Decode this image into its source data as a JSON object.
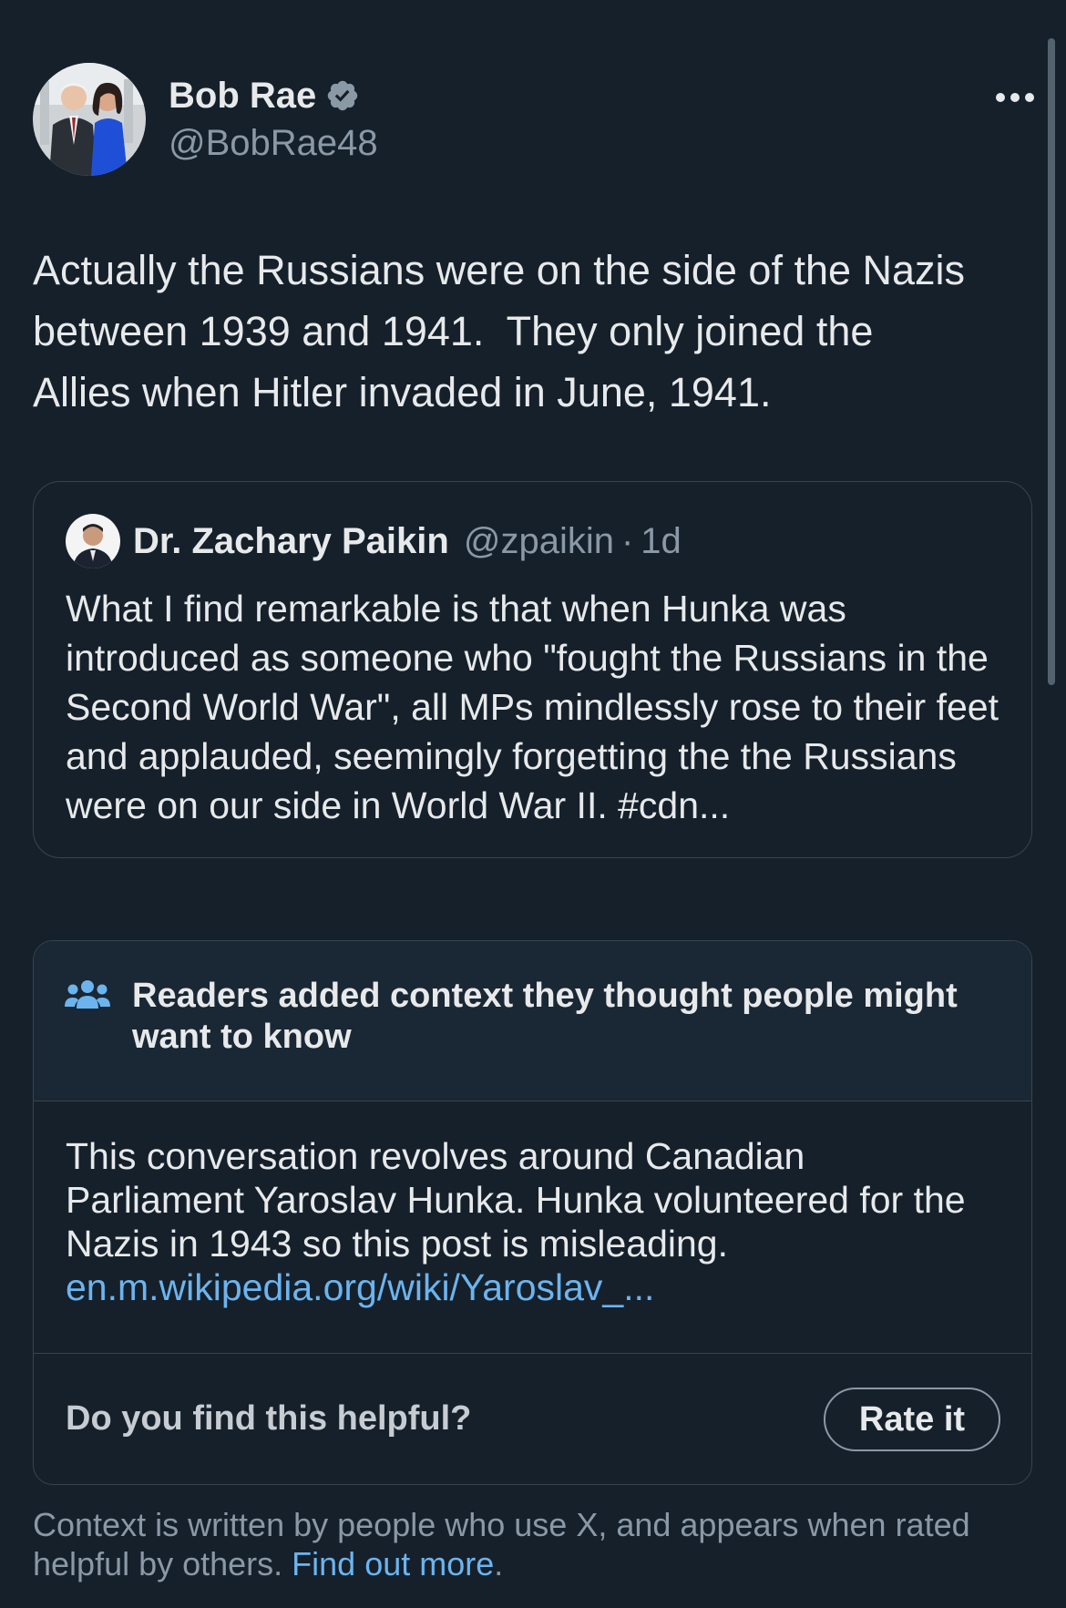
{
  "post": {
    "author_name": "Bob Rae",
    "author_handle": "@BobRae48",
    "verified_icon": "verified-badge-icon",
    "more_icon": "more-options-icon",
    "text": "Actually the Russians were on the side of the Nazis\nbetween 1939 and 1941.  They only joined the\nAllies when Hitler invaded in June, 1941."
  },
  "quoted_post": {
    "author_name": "Dr. Zachary Paikin",
    "author_handle": "@zpaikin",
    "separator": "·",
    "time": "1d",
    "text": "What I find remarkable is that when Hunka was introduced as someone who \"fought the Russians in the Second World War\", all MPs mindlessly rose to their feet and applauded, seemingly forgetting the the Russians were on our side in World War II. #cdn..."
  },
  "community_note": {
    "icon": "readers-icon",
    "title": "Readers added context they thought people might want to know",
    "body": "This conversation revolves around Canadian Parliament Yaroslav Hunka. Hunka volunteered for the Nazis in 1943 so this post is misleading.",
    "link_text": "en.m.wikipedia.org/wiki/Yaroslav_...",
    "helpful_question": "Do you find this helpful?",
    "rate_button": "Rate it"
  },
  "disclaimer": {
    "text": "Context is written by people who use X, and appears when rated helpful by others. ",
    "link_text": "Find out more",
    "suffix": "."
  },
  "colors": {
    "background": "#15202b",
    "text": "#e7e9ea",
    "secondary_text": "#8b98a5",
    "link": "#6cb4ee",
    "border": "#38444d",
    "verified": "#8b98a5"
  }
}
